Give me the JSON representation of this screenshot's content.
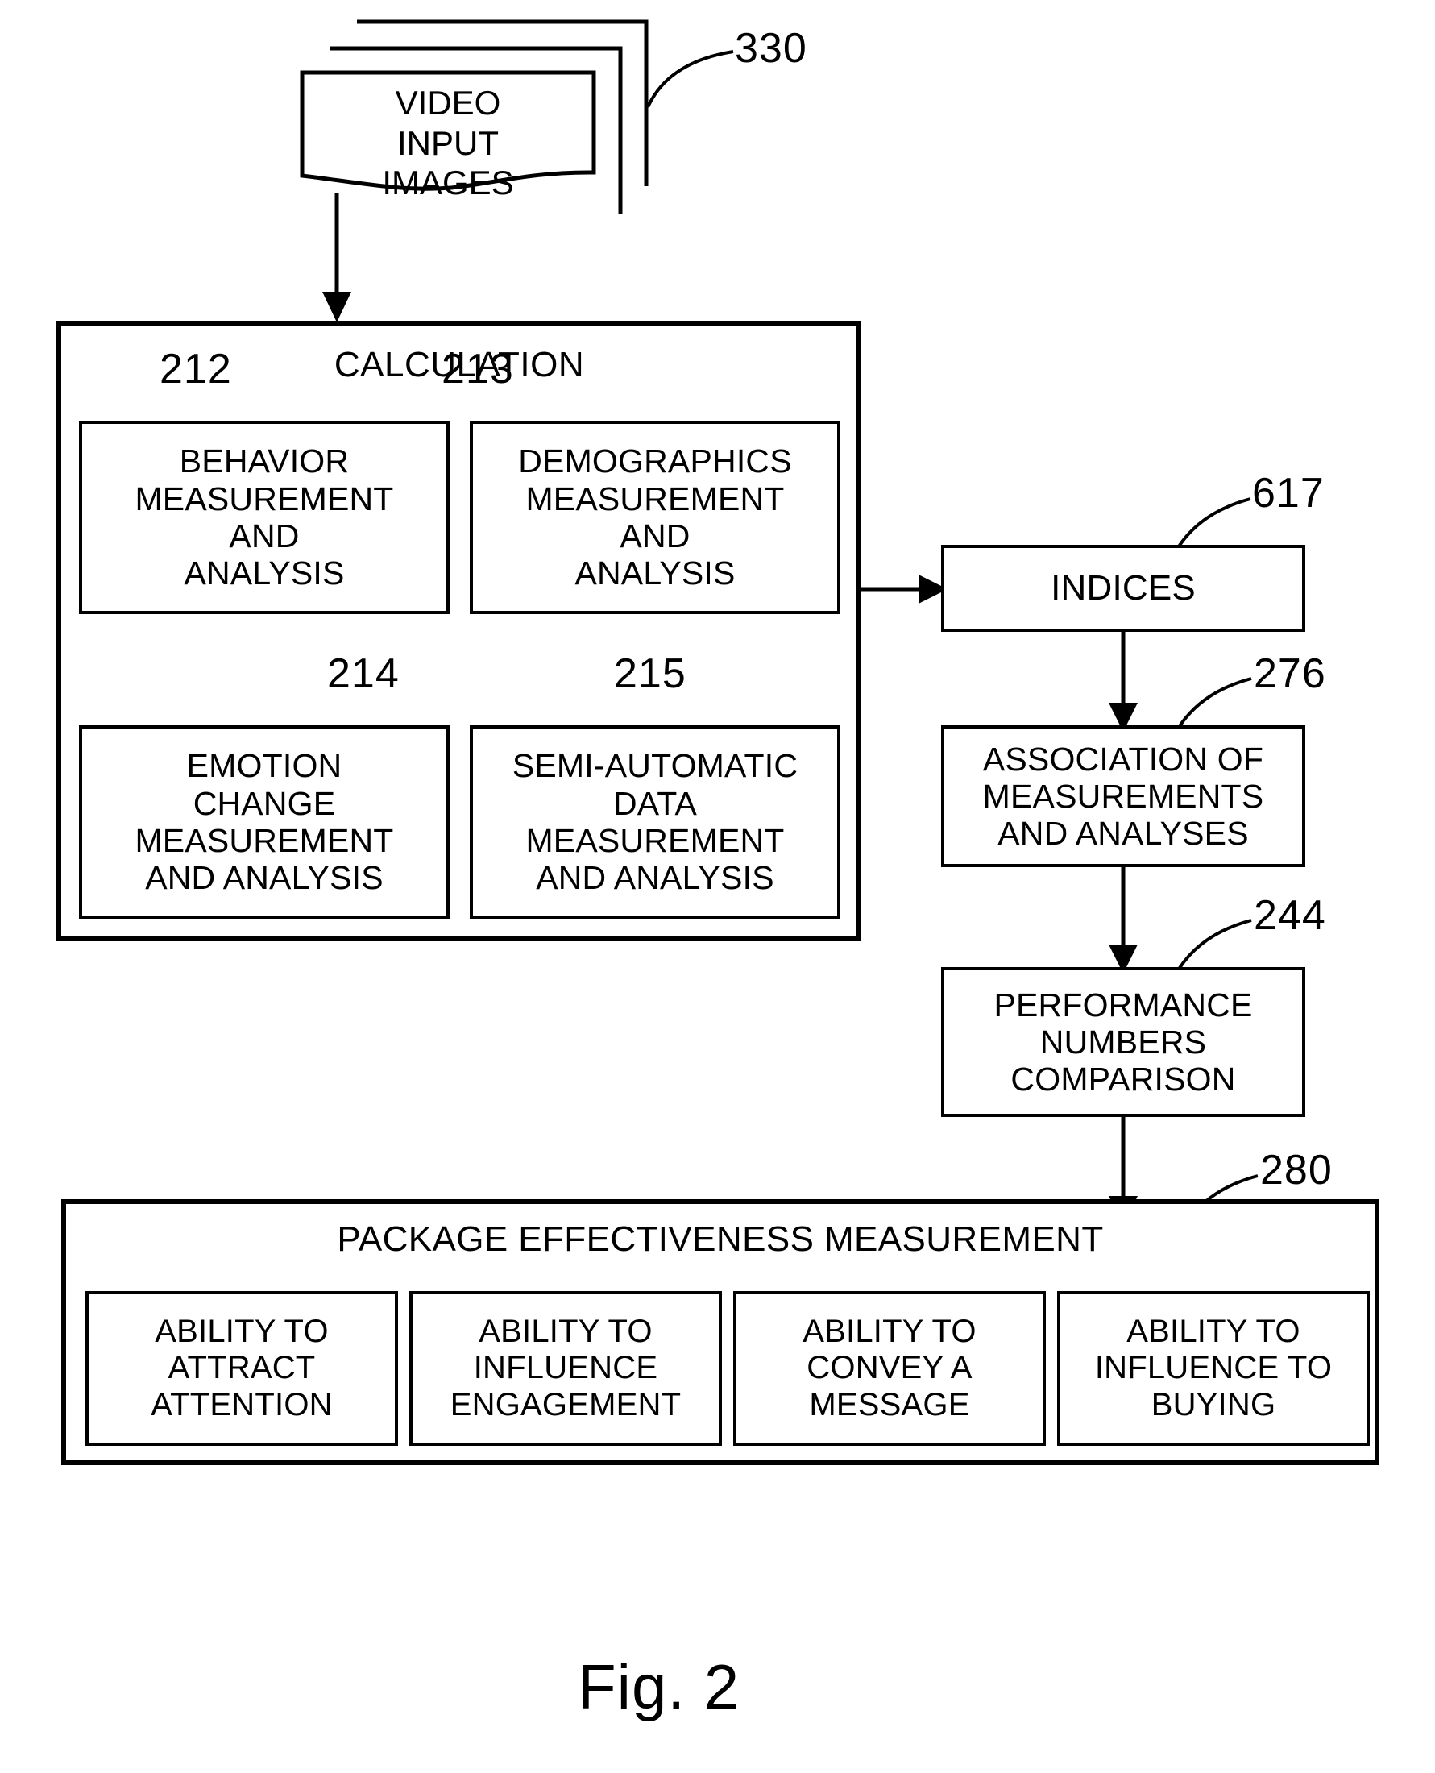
{
  "figure": {
    "caption": "Fig. 2",
    "title_block": "CALCULATION",
    "source_label": "VIDEO\nINPUT\nIMAGES",
    "source_ref": "330"
  },
  "calculation": {
    "title": "CALCULATION",
    "refs": {
      "behavior": "212",
      "demographics": "213",
      "emotion": "214",
      "semi_automatic": "215"
    },
    "boxes": [
      {
        "ref": "212",
        "label": "BEHAVIOR\nMEASUREMENT\nAND\nANALYSIS"
      },
      {
        "ref": "213",
        "label": "DEMOGRAPHICS\nMEASUREMENT\nAND\nANALYSIS"
      },
      {
        "ref": "214",
        "label": "EMOTION\nCHANGE\nMEASUREMENT\nAND ANALYSIS"
      },
      {
        "ref": "215",
        "label": "SEMI-AUTOMATIC\nDATA\nMEASUREMENT\nAND ANALYSIS"
      }
    ]
  },
  "pipeline": {
    "indices": {
      "ref": "617",
      "label": "INDICES"
    },
    "association": {
      "ref": "276",
      "label": "ASSOCIATION OF\nMEASUREMENTS\nAND ANALYSES"
    },
    "performance": {
      "ref": "244",
      "label": "PERFORMANCE\nNUMBERS\nCOMPARISON"
    }
  },
  "package": {
    "ref": "280",
    "title": "PACKAGE EFFECTIVENESS MEASUREMENT",
    "items": [
      {
        "label": "ABILITY TO\nATTRACT\nATTENTION"
      },
      {
        "label": "ABILITY TO\nINFLUENCE\nENGAGEMENT"
      },
      {
        "label": "ABILITY TO\nCONVEY A\nMESSAGE"
      },
      {
        "label": "ABILITY TO\nINFLUENCE TO\nBUYING"
      }
    ]
  },
  "colors": {
    "ink": "#000000",
    "paper": "#ffffff"
  }
}
